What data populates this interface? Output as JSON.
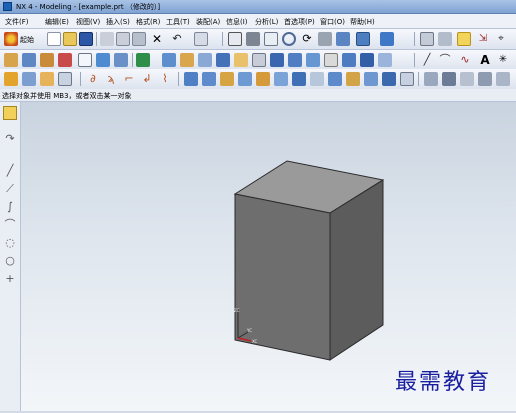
{
  "window": {
    "title": "NX 4 - Modeling - [example.prt （修改的）]"
  },
  "menu": {
    "items": [
      "文件(F)",
      "编辑(E)",
      "视图(V)",
      "插入(S)",
      "格式(R)",
      "工具(T)",
      "装配(A)",
      "信息(I)",
      "分析(L)",
      "首选项(P)",
      "窗口(O)",
      "帮助(H)"
    ]
  },
  "toolbar": {
    "start_label": "起始"
  },
  "status": {
    "message": "选择对象并使用 MB3，或者双击某一对象"
  },
  "viewport": {
    "triad_labels": [
      "ZC",
      "YC",
      "XC"
    ]
  },
  "watermark": {
    "text": "最需教育"
  },
  "colors": {
    "title_bar": "#8fb0dc",
    "viewport_top": "#c9d3df",
    "viewport_bottom": "#f3f6f9",
    "cube_front": "#6e6e6e",
    "cube_side": "#5c5c5c",
    "cube_top": "#9a9a9a",
    "watermark": "#1a1fa0"
  }
}
